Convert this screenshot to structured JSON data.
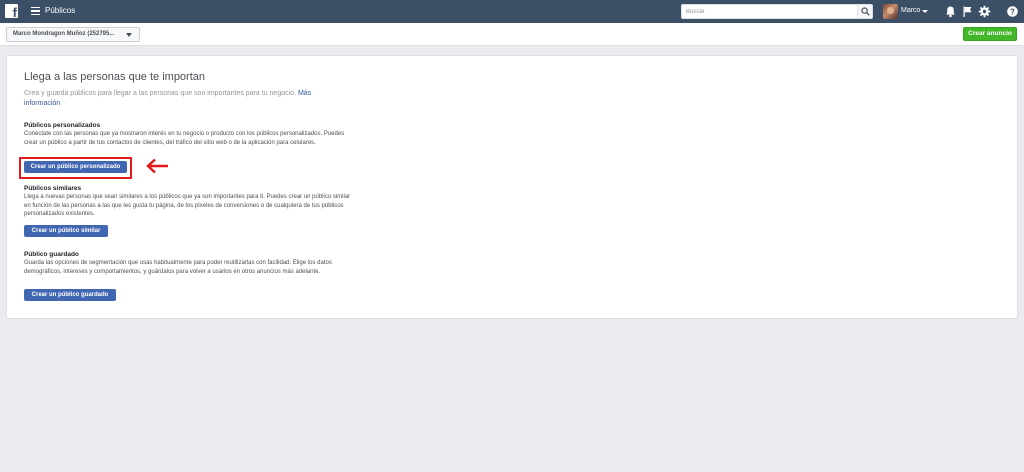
{
  "topbar": {
    "app_title": "Públicos",
    "search_placeholder": "Buscar",
    "user_name": "Marco"
  },
  "subbar": {
    "account_selector": "Marco Mondragon Muñoz (252795...",
    "create_ad_label": "Crear anuncio"
  },
  "main": {
    "title": "Llega a las personas que te importan",
    "subtitle": "Crea y guarda públicos para llegar a las personas que son importantes para tu negocio.",
    "more_info_link": "Más información",
    "sections": [
      {
        "title": "Públicos personalizados",
        "description": "Conéctate con las personas que ya mostraron interés en tu negocio o producto con los públicos personalizados. Puedes crear un público a partir de tus contactos de clientes, del tráfico del sitio web o de la aplicación para celulares.",
        "button": "Crear un público personalizado"
      },
      {
        "title": "Públicos similares",
        "description": "Llega a nuevas personas que sean similares a los públicos que ya son importantes para ti. Puedes crear un público similar en función de las personas a las que les gusta tu página, de los píxeles de conversiones o de cualquiera de tus públicos personalizados existentes.",
        "button": "Crear un público similar"
      },
      {
        "title": "Público guardado",
        "description": "Guarda las opciones de segmentación que usas habitualmente para poder reutilizarlas con facilidad. Elige los datos demográficos, intereses y comportamientos, y guárdalos para volver a usarlos en otros anuncios más adelante.",
        "button": "Crear un público guardado"
      }
    ]
  },
  "colors": {
    "topbar": "#3b4f66",
    "button_blue": "#4267b2",
    "button_green": "#42b72a",
    "highlight_red": "#e11a1a",
    "link": "#365899"
  },
  "icons": [
    "facebook-logo",
    "menu-icon",
    "search-icon",
    "bell-icon",
    "flag-icon",
    "gear-icon",
    "help-icon",
    "arrow-left-icon"
  ]
}
